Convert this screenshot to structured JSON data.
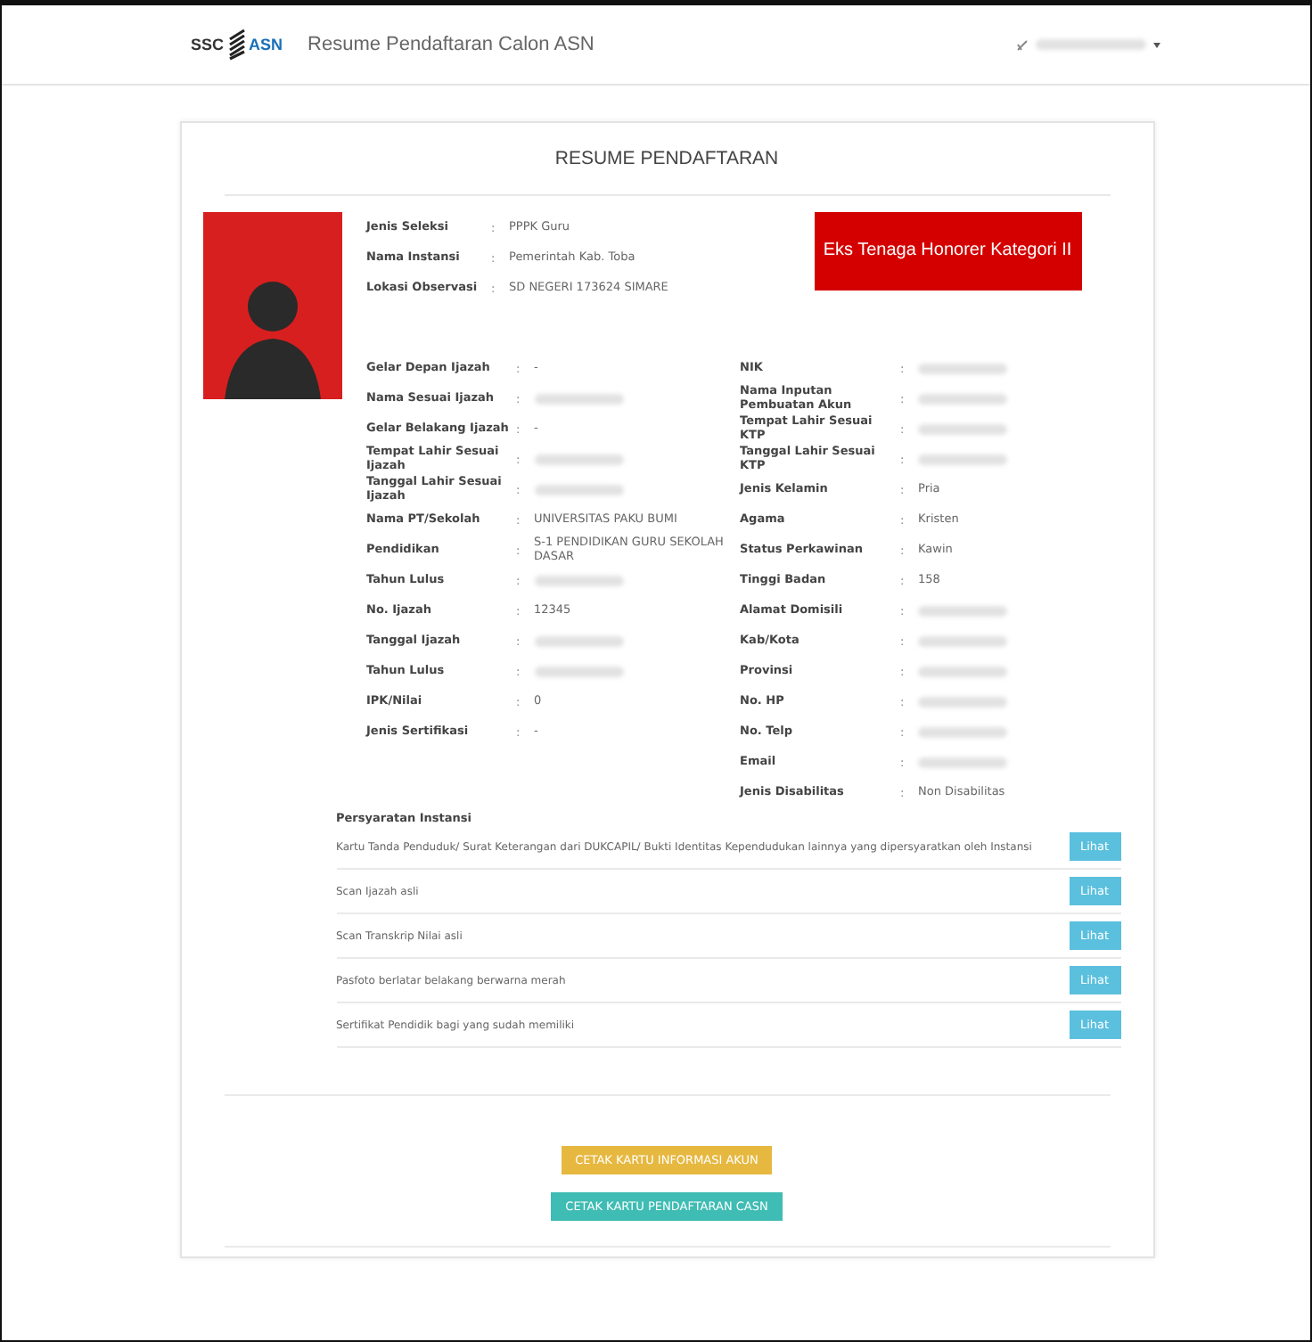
{
  "header": {
    "logo": {
      "left": "SSC",
      "right": "ASN"
    },
    "title": "Resume Pendaftaran Calon ASN",
    "user": {
      "redacted": true
    }
  },
  "card": {
    "title": "RESUME PENDAFTARAN",
    "summary": [
      {
        "label": "Jenis Seleksi",
        "sep": ":",
        "value": "PPPK Guru"
      },
      {
        "label": "Nama Instansi",
        "sep": ":",
        "value": "Pemerintah Kab. Toba"
      },
      {
        "label": "Lokasi Observasi",
        "sep": ":",
        "value": "SD NEGERI 173624 SIMARE"
      }
    ],
    "category_badge": "Eks Tenaga Honorer Kategori II",
    "left_fields": [
      {
        "label": "Gelar Depan Ijazah",
        "sep": ":",
        "value": "-",
        "redacted": false
      },
      {
        "label": "Nama Sesuai Ijazah",
        "sep": ":",
        "redacted": true
      },
      {
        "label": "Gelar Belakang Ijazah",
        "sep": ":",
        "value": "-",
        "redacted": false
      },
      {
        "label": "Tempat Lahir Sesuai Ijazah",
        "sep": ":",
        "redacted": true
      },
      {
        "label": "Tanggal Lahir Sesuai Ijazah",
        "sep": ":",
        "redacted": true
      },
      {
        "label": "Nama PT/Sekolah",
        "sep": ":",
        "value": "UNIVERSITAS PAKU BUMI",
        "redacted": false
      },
      {
        "label": "Pendidikan",
        "sep": ":",
        "value": "S-1 PENDIDIKAN GURU SEKOLAH DASAR",
        "redacted": false
      },
      {
        "label": "Tahun Lulus",
        "sep": ":",
        "redacted": true
      },
      {
        "label": "No. Ijazah",
        "sep": ":",
        "value": "12345",
        "redacted": false
      },
      {
        "label": "Tanggal Ijazah",
        "sep": ":",
        "redacted": true
      },
      {
        "label": "Tahun Lulus",
        "sep": ":",
        "redacted": true
      },
      {
        "label": "IPK/Nilai",
        "sep": ":",
        "value": "0",
        "redacted": false
      },
      {
        "label": "Jenis Sertifikasi",
        "sep": ":",
        "value": "-",
        "redacted": false
      }
    ],
    "right_fields": [
      {
        "label": "NIK",
        "sep": ":",
        "redacted": true
      },
      {
        "label": "Nama Inputan Pembuatan Akun",
        "sep": ":",
        "redacted": true
      },
      {
        "label": "Tempat Lahir Sesuai KTP",
        "sep": ":",
        "redacted": true
      },
      {
        "label": "Tanggal Lahir Sesuai KTP",
        "sep": ":",
        "redacted": true
      },
      {
        "label": "Jenis Kelamin",
        "sep": ":",
        "value": "Pria",
        "redacted": false
      },
      {
        "label": "Agama",
        "sep": ":",
        "value": "Kristen",
        "redacted": false
      },
      {
        "label": "Status Perkawinan",
        "sep": ":",
        "value": "Kawin",
        "redacted": false
      },
      {
        "label": "Tinggi Badan",
        "sep": ":",
        "value": "158",
        "redacted": false
      },
      {
        "label": "Alamat Domisili",
        "sep": ":",
        "redacted": true
      },
      {
        "label": "Kab/Kota",
        "sep": ":",
        "redacted": true
      },
      {
        "label": "Provinsi",
        "sep": ":",
        "redacted": true
      },
      {
        "label": "No. HP",
        "sep": ":",
        "redacted": true
      },
      {
        "label": "No. Telp",
        "sep": ":",
        "redacted": true
      },
      {
        "label": "Email",
        "sep": ":",
        "redacted": true
      },
      {
        "label": "Jenis Disabilitas",
        "sep": ":",
        "value": "Non Disabilitas",
        "redacted": false
      }
    ],
    "requirements_title": "Persyaratan Instansi",
    "requirements": [
      {
        "text": "Kartu Tanda Penduduk/ Surat Keterangan dari DUKCAPIL/ Bukti Identitas Kependudukan lainnya yang dipersyaratkan oleh Instansi",
        "button": "Lihat"
      },
      {
        "text": "Scan Ijazah asli",
        "button": "Lihat"
      },
      {
        "text": "Scan Transkrip Nilai asli",
        "button": "Lihat"
      },
      {
        "text": "Pasfoto berlatar belakang berwarna merah",
        "button": "Lihat"
      },
      {
        "text": "Sertifikat Pendidik bagi yang sudah memiliki",
        "button": "Lihat"
      }
    ],
    "actions": [
      {
        "label": "CETAK KARTU INFORMASI AKUN",
        "kind": "warning"
      },
      {
        "label": "CETAK KARTU PENDAFTARAN CASN",
        "kind": "info"
      }
    ]
  }
}
